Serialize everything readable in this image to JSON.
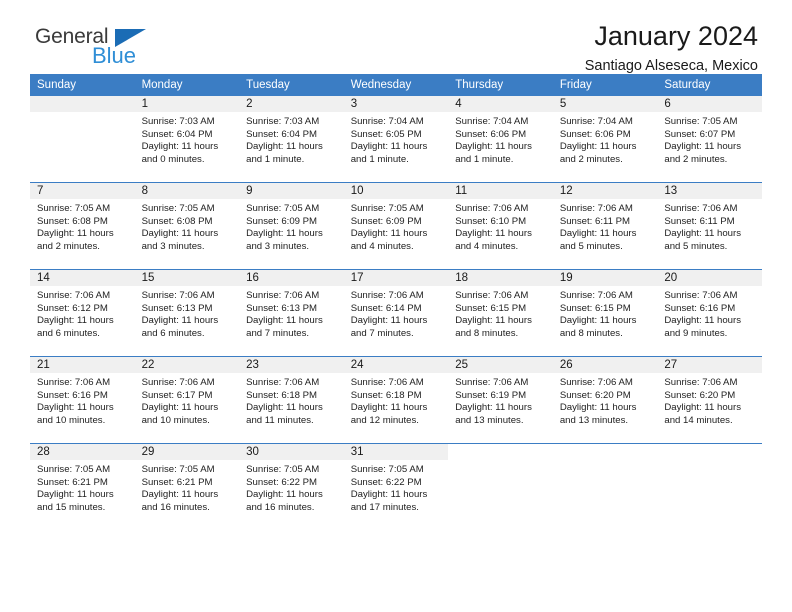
{
  "brand": {
    "word_one": "General",
    "word_two": "Blue",
    "triangle_color": "#1b6cb5",
    "blue_text_color": "#2f8ed6"
  },
  "header": {
    "title": "January 2024",
    "subtitle": "Santiago Alseseca, Mexico"
  },
  "theme": {
    "header_bg": "#3b7dc4",
    "daynum_bg": "#f0f0f0",
    "grid_line": "#3b7dc4"
  },
  "weekday_headers": [
    "Sunday",
    "Monday",
    "Tuesday",
    "Wednesday",
    "Thursday",
    "Friday",
    "Saturday"
  ],
  "weeks": [
    [
      {
        "day": "",
        "empty": true,
        "sunrise": "",
        "sunset": "",
        "daylight_line1": "",
        "daylight_line2": ""
      },
      {
        "day": "1",
        "sunrise": "Sunrise: 7:03 AM",
        "sunset": "Sunset: 6:04 PM",
        "daylight_line1": "Daylight: 11 hours",
        "daylight_line2": "and 0 minutes."
      },
      {
        "day": "2",
        "sunrise": "Sunrise: 7:03 AM",
        "sunset": "Sunset: 6:04 PM",
        "daylight_line1": "Daylight: 11 hours",
        "daylight_line2": "and 1 minute."
      },
      {
        "day": "3",
        "sunrise": "Sunrise: 7:04 AM",
        "sunset": "Sunset: 6:05 PM",
        "daylight_line1": "Daylight: 11 hours",
        "daylight_line2": "and 1 minute."
      },
      {
        "day": "4",
        "sunrise": "Sunrise: 7:04 AM",
        "sunset": "Sunset: 6:06 PM",
        "daylight_line1": "Daylight: 11 hours",
        "daylight_line2": "and 1 minute."
      },
      {
        "day": "5",
        "sunrise": "Sunrise: 7:04 AM",
        "sunset": "Sunset: 6:06 PM",
        "daylight_line1": "Daylight: 11 hours",
        "daylight_line2": "and 2 minutes."
      },
      {
        "day": "6",
        "sunrise": "Sunrise: 7:05 AM",
        "sunset": "Sunset: 6:07 PM",
        "daylight_line1": "Daylight: 11 hours",
        "daylight_line2": "and 2 minutes."
      }
    ],
    [
      {
        "day": "7",
        "sunrise": "Sunrise: 7:05 AM",
        "sunset": "Sunset: 6:08 PM",
        "daylight_line1": "Daylight: 11 hours",
        "daylight_line2": "and 2 minutes."
      },
      {
        "day": "8",
        "sunrise": "Sunrise: 7:05 AM",
        "sunset": "Sunset: 6:08 PM",
        "daylight_line1": "Daylight: 11 hours",
        "daylight_line2": "and 3 minutes."
      },
      {
        "day": "9",
        "sunrise": "Sunrise: 7:05 AM",
        "sunset": "Sunset: 6:09 PM",
        "daylight_line1": "Daylight: 11 hours",
        "daylight_line2": "and 3 minutes."
      },
      {
        "day": "10",
        "sunrise": "Sunrise: 7:05 AM",
        "sunset": "Sunset: 6:09 PM",
        "daylight_line1": "Daylight: 11 hours",
        "daylight_line2": "and 4 minutes."
      },
      {
        "day": "11",
        "sunrise": "Sunrise: 7:06 AM",
        "sunset": "Sunset: 6:10 PM",
        "daylight_line1": "Daylight: 11 hours",
        "daylight_line2": "and 4 minutes."
      },
      {
        "day": "12",
        "sunrise": "Sunrise: 7:06 AM",
        "sunset": "Sunset: 6:11 PM",
        "daylight_line1": "Daylight: 11 hours",
        "daylight_line2": "and 5 minutes."
      },
      {
        "day": "13",
        "sunrise": "Sunrise: 7:06 AM",
        "sunset": "Sunset: 6:11 PM",
        "daylight_line1": "Daylight: 11 hours",
        "daylight_line2": "and 5 minutes."
      }
    ],
    [
      {
        "day": "14",
        "sunrise": "Sunrise: 7:06 AM",
        "sunset": "Sunset: 6:12 PM",
        "daylight_line1": "Daylight: 11 hours",
        "daylight_line2": "and 6 minutes."
      },
      {
        "day": "15",
        "sunrise": "Sunrise: 7:06 AM",
        "sunset": "Sunset: 6:13 PM",
        "daylight_line1": "Daylight: 11 hours",
        "daylight_line2": "and 6 minutes."
      },
      {
        "day": "16",
        "sunrise": "Sunrise: 7:06 AM",
        "sunset": "Sunset: 6:13 PM",
        "daylight_line1": "Daylight: 11 hours",
        "daylight_line2": "and 7 minutes."
      },
      {
        "day": "17",
        "sunrise": "Sunrise: 7:06 AM",
        "sunset": "Sunset: 6:14 PM",
        "daylight_line1": "Daylight: 11 hours",
        "daylight_line2": "and 7 minutes."
      },
      {
        "day": "18",
        "sunrise": "Sunrise: 7:06 AM",
        "sunset": "Sunset: 6:15 PM",
        "daylight_line1": "Daylight: 11 hours",
        "daylight_line2": "and 8 minutes."
      },
      {
        "day": "19",
        "sunrise": "Sunrise: 7:06 AM",
        "sunset": "Sunset: 6:15 PM",
        "daylight_line1": "Daylight: 11 hours",
        "daylight_line2": "and 8 minutes."
      },
      {
        "day": "20",
        "sunrise": "Sunrise: 7:06 AM",
        "sunset": "Sunset: 6:16 PM",
        "daylight_line1": "Daylight: 11 hours",
        "daylight_line2": "and 9 minutes."
      }
    ],
    [
      {
        "day": "21",
        "sunrise": "Sunrise: 7:06 AM",
        "sunset": "Sunset: 6:16 PM",
        "daylight_line1": "Daylight: 11 hours",
        "daylight_line2": "and 10 minutes."
      },
      {
        "day": "22",
        "sunrise": "Sunrise: 7:06 AM",
        "sunset": "Sunset: 6:17 PM",
        "daylight_line1": "Daylight: 11 hours",
        "daylight_line2": "and 10 minutes."
      },
      {
        "day": "23",
        "sunrise": "Sunrise: 7:06 AM",
        "sunset": "Sunset: 6:18 PM",
        "daylight_line1": "Daylight: 11 hours",
        "daylight_line2": "and 11 minutes."
      },
      {
        "day": "24",
        "sunrise": "Sunrise: 7:06 AM",
        "sunset": "Sunset: 6:18 PM",
        "daylight_line1": "Daylight: 11 hours",
        "daylight_line2": "and 12 minutes."
      },
      {
        "day": "25",
        "sunrise": "Sunrise: 7:06 AM",
        "sunset": "Sunset: 6:19 PM",
        "daylight_line1": "Daylight: 11 hours",
        "daylight_line2": "and 13 minutes."
      },
      {
        "day": "26",
        "sunrise": "Sunrise: 7:06 AM",
        "sunset": "Sunset: 6:20 PM",
        "daylight_line1": "Daylight: 11 hours",
        "daylight_line2": "and 13 minutes."
      },
      {
        "day": "27",
        "sunrise": "Sunrise: 7:06 AM",
        "sunset": "Sunset: 6:20 PM",
        "daylight_line1": "Daylight: 11 hours",
        "daylight_line2": "and 14 minutes."
      }
    ],
    [
      {
        "day": "28",
        "sunrise": "Sunrise: 7:05 AM",
        "sunset": "Sunset: 6:21 PM",
        "daylight_line1": "Daylight: 11 hours",
        "daylight_line2": "and 15 minutes."
      },
      {
        "day": "29",
        "sunrise": "Sunrise: 7:05 AM",
        "sunset": "Sunset: 6:21 PM",
        "daylight_line1": "Daylight: 11 hours",
        "daylight_line2": "and 16 minutes."
      },
      {
        "day": "30",
        "sunrise": "Sunrise: 7:05 AM",
        "sunset": "Sunset: 6:22 PM",
        "daylight_line1": "Daylight: 11 hours",
        "daylight_line2": "and 16 minutes."
      },
      {
        "day": "31",
        "sunrise": "Sunrise: 7:05 AM",
        "sunset": "Sunset: 6:22 PM",
        "daylight_line1": "Daylight: 11 hours",
        "daylight_line2": "and 17 minutes."
      },
      {
        "day": "",
        "blank": true,
        "sunrise": "",
        "sunset": "",
        "daylight_line1": "",
        "daylight_line2": ""
      },
      {
        "day": "",
        "blank": true,
        "sunrise": "",
        "sunset": "",
        "daylight_line1": "",
        "daylight_line2": ""
      },
      {
        "day": "",
        "blank": true,
        "sunrise": "",
        "sunset": "",
        "daylight_line1": "",
        "daylight_line2": ""
      }
    ]
  ]
}
